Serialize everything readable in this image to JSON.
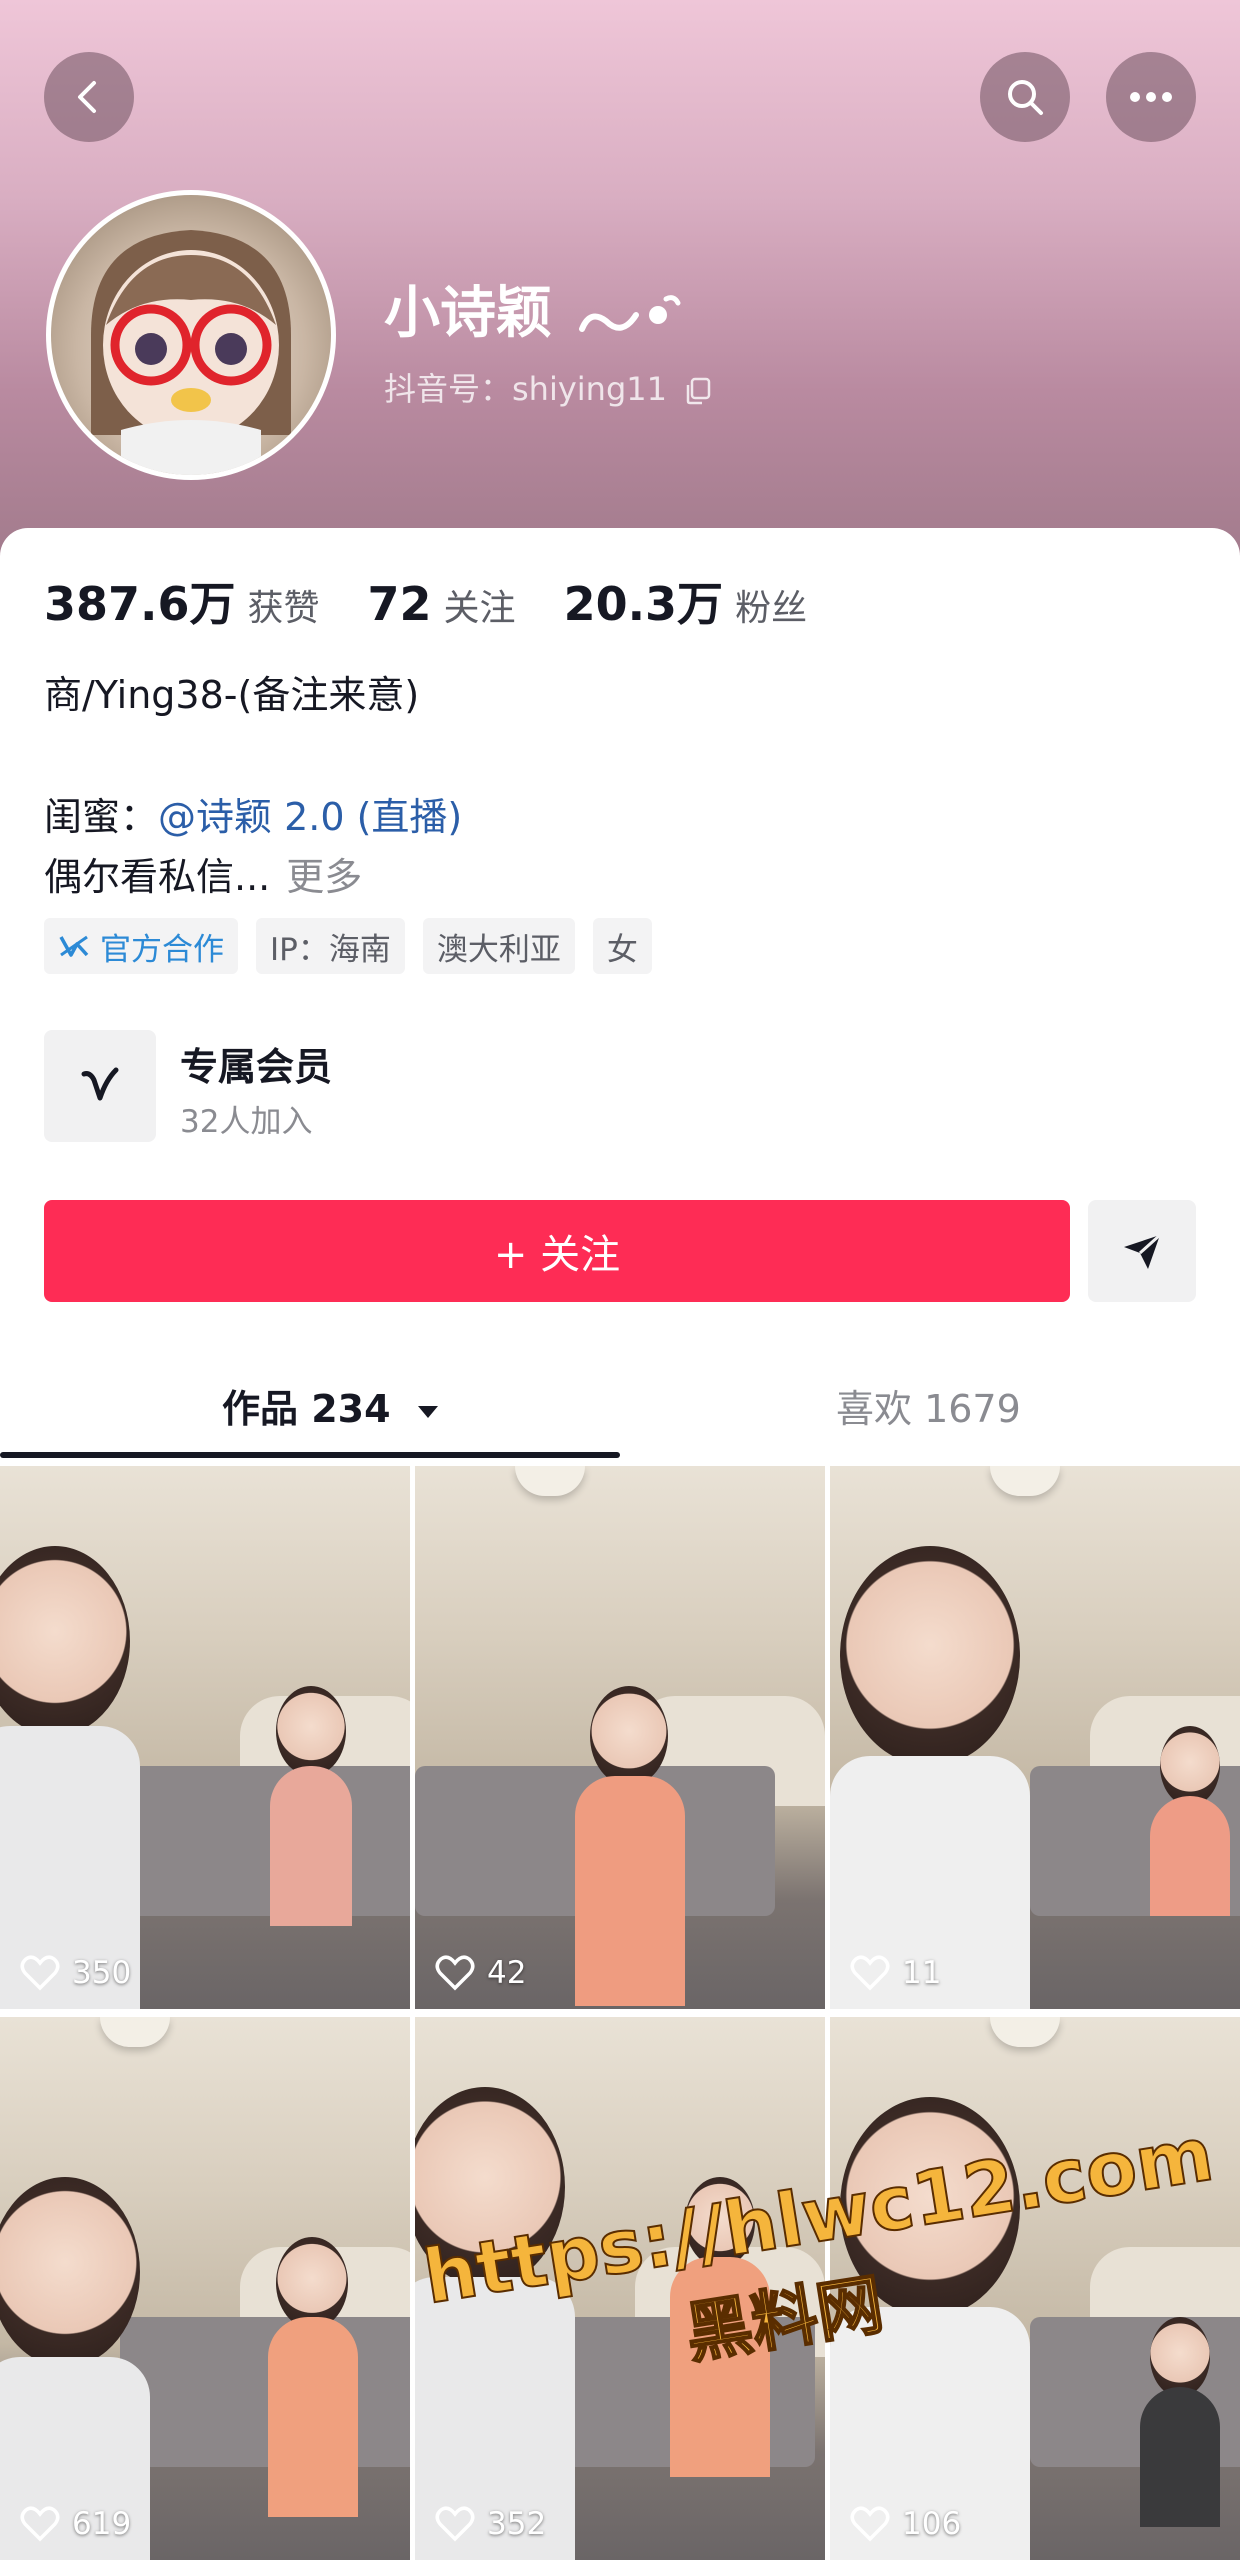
{
  "profile": {
    "nickname": "小诗颖",
    "handle": "抖音号：shiying11"
  },
  "stats": {
    "likes_value": "387.6万",
    "likes_label": "获赞",
    "following_value": "72",
    "following_label": "关注",
    "followers_value": "20.3万",
    "followers_label": "粉丝"
  },
  "bio": {
    "line1": "商/Ying38-(备注来意)",
    "line2_prefix": "闺蜜：",
    "line2_mention": "@诗颖 2.0 (直播)",
    "line3": "偶尔看私信...",
    "more": "更多"
  },
  "tags": {
    "official": "官方合作",
    "ip": "IP：海南",
    "region": "澳大利亚",
    "gender": "女"
  },
  "membership": {
    "title": "专属会员",
    "subtitle": "32人加入"
  },
  "actions": {
    "follow": "+ 关注"
  },
  "tabs": {
    "works": "作品 234",
    "likes": "喜欢 1679"
  },
  "videos": [
    {
      "likes": "350"
    },
    {
      "likes": "42"
    },
    {
      "likes": "11"
    },
    {
      "likes": "619"
    },
    {
      "likes": "352"
    },
    {
      "likes": "106"
    }
  ],
  "watermark": {
    "url": "https://hlwc12.com",
    "name": "黑料网"
  },
  "icons": {
    "back": "chevron-left-icon",
    "search": "search-icon",
    "more": "more-dots-icon",
    "copy": "copy-icon",
    "share": "send-icon"
  },
  "colors": {
    "accent": "#fe2c55",
    "mention": "#2b5ea8",
    "official": "#2c8ad6"
  }
}
